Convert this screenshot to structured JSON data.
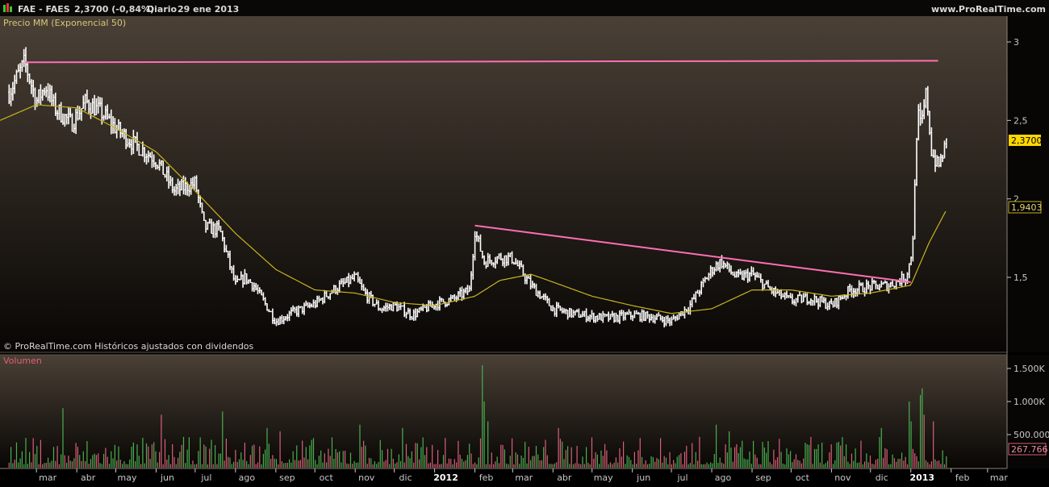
{
  "header": {
    "ticker": "FAE - FAES",
    "quote": "2,3700 (-0,84%)",
    "period": "Diario",
    "date": "29 ene 2013",
    "site": "www.ProRealTime.com"
  },
  "price_panel": {
    "indicator_label": "Precio MM (Exponencial 50)",
    "copyright": "© ProRealTime.com Históricos ajustados con dividendos",
    "last_price_tag": "2,3700",
    "ema_tag": "1,9403"
  },
  "volume_panel": {
    "label": "Volumen",
    "last_volume_tag": "267.766"
  },
  "colors": {
    "background_top": "#4a4036",
    "background_bottom": "#080604",
    "price_bars": "#ffffff",
    "ema_line": "#c8b41e",
    "trend_lines": "#ff6eb4",
    "volume_up": "#4caf50",
    "volume_down": "#d9607a",
    "price_tag_bg": "#ffd700",
    "axis_text": "#c8c8c8"
  },
  "chart_data": [
    {
      "type": "ohlc",
      "title": "FAE - FAES",
      "y_ticks": [
        "3",
        "2,5",
        "2",
        "1,5"
      ],
      "y_tick_values": [
        3,
        2.5,
        2,
        1.5
      ],
      "ylim": [
        1.13,
        3.1
      ],
      "x_ticks": [
        "mar",
        "abr",
        "may",
        "jun",
        "jul",
        "ago",
        "sep",
        "oct",
        "nov",
        "dic",
        "2012",
        "feb",
        "mar",
        "abr",
        "may",
        "jun",
        "jul",
        "ago",
        "sep",
        "oct",
        "nov",
        "dic",
        "2013",
        "feb",
        "mar"
      ],
      "x_tick_dates": [
        "2011-03-01",
        "2011-04-01",
        "2011-05-01",
        "2011-06-01",
        "2011-07-01",
        "2011-08-01",
        "2011-09-01",
        "2011-10-01",
        "2011-11-01",
        "2011-12-01",
        "2012-01-01",
        "2012-02-01",
        "2012-03-01",
        "2012-04-01",
        "2012-05-01",
        "2012-06-01",
        "2012-07-01",
        "2012-08-01",
        "2012-09-01",
        "2012-10-01",
        "2012-11-01",
        "2012-12-01",
        "2013-01-01",
        "2013-02-01",
        "2013-03-01"
      ],
      "x_bold_ticks": [
        "2012",
        "2013"
      ],
      "price_series": {
        "name": "FAE - FAES",
        "x": [
          "2011-02-08",
          "2011-02-20",
          "2011-03-01",
          "2011-03-08",
          "2011-03-15",
          "2011-03-28",
          "2011-04-08",
          "2011-04-20",
          "2011-05-01",
          "2011-05-15",
          "2011-06-01",
          "2011-06-15",
          "2011-07-01",
          "2011-07-08",
          "2011-07-20",
          "2011-08-01",
          "2011-08-08",
          "2011-08-15",
          "2011-09-01",
          "2011-09-15",
          "2011-10-01",
          "2011-10-15",
          "2011-11-01",
          "2011-11-08",
          "2011-11-20",
          "2011-12-01",
          "2011-12-15",
          "2012-01-01",
          "2012-01-15",
          "2012-01-28",
          "2012-02-01",
          "2012-02-08",
          "2012-02-20",
          "2012-03-01",
          "2012-03-15",
          "2012-04-01",
          "2012-04-15",
          "2012-05-01",
          "2012-05-15",
          "2012-06-01",
          "2012-06-15",
          "2012-07-01",
          "2012-07-15",
          "2012-08-01",
          "2012-08-08",
          "2012-08-20",
          "2012-09-01",
          "2012-09-15",
          "2012-10-01",
          "2012-10-15",
          "2012-11-01",
          "2012-11-15",
          "2012-12-01",
          "2012-12-15",
          "2012-12-28",
          "2013-01-01",
          "2013-01-03",
          "2013-01-06",
          "2013-01-09",
          "2013-01-13",
          "2013-01-17",
          "2013-01-22",
          "2013-01-29"
        ],
        "close": [
          2.68,
          2.87,
          2.62,
          2.72,
          2.58,
          2.48,
          2.62,
          2.55,
          2.45,
          2.35,
          2.25,
          2.05,
          2.1,
          1.82,
          1.8,
          1.45,
          1.5,
          1.45,
          1.22,
          1.28,
          1.33,
          1.42,
          1.5,
          1.4,
          1.3,
          1.32,
          1.26,
          1.33,
          1.36,
          1.42,
          1.8,
          1.6,
          1.63,
          1.62,
          1.45,
          1.3,
          1.27,
          1.25,
          1.24,
          1.26,
          1.25,
          1.22,
          1.32,
          1.55,
          1.6,
          1.5,
          1.52,
          1.42,
          1.35,
          1.37,
          1.32,
          1.42,
          1.44,
          1.45,
          1.5,
          1.62,
          1.8,
          2.55,
          2.45,
          2.68,
          2.3,
          2.2,
          2.37
        ]
      },
      "ema_series": {
        "name": "Exponencial 50",
        "x": [
          "2011-02-01",
          "2011-03-01",
          "2011-04-01",
          "2011-05-01",
          "2011-06-01",
          "2011-07-01",
          "2011-08-01",
          "2011-09-01",
          "2011-10-01",
          "2011-11-01",
          "2011-12-01",
          "2012-01-01",
          "2012-02-01",
          "2012-02-20",
          "2012-03-15",
          "2012-04-01",
          "2012-05-01",
          "2012-06-01",
          "2012-07-01",
          "2012-08-01",
          "2012-09-01",
          "2012-10-01",
          "2012-11-01",
          "2012-12-01",
          "2013-01-01",
          "2013-01-15",
          "2013-01-29"
        ],
        "y": [
          2.5,
          2.6,
          2.58,
          2.45,
          2.3,
          2.05,
          1.78,
          1.55,
          1.42,
          1.4,
          1.34,
          1.32,
          1.38,
          1.48,
          1.52,
          1.47,
          1.38,
          1.32,
          1.27,
          1.3,
          1.42,
          1.42,
          1.38,
          1.4,
          1.45,
          1.72,
          1.94
        ]
      },
      "trend_lines": [
        {
          "from": {
            "x": "2011-02-20",
            "y": 2.87
          },
          "to": {
            "x": "2013-01-22",
            "y": 2.88
          }
        },
        {
          "from": {
            "x": "2012-02-01",
            "y": 1.83
          },
          "to": {
            "x": "2013-01-01",
            "y": 1.47
          }
        }
      ],
      "last_price": 2.37,
      "last_ema": 1.9403
    },
    {
      "type": "bar",
      "title": "Volumen",
      "y_ticks": [
        "1.500K",
        "1.000K",
        "500.000"
      ],
      "y_tick_values": [
        1500000,
        1000000,
        500000
      ],
      "ylim": [
        0,
        1600000
      ],
      "spikes": [
        {
          "x": "2011-03-22",
          "y": 900000,
          "dir": "up"
        },
        {
          "x": "2011-06-05",
          "y": 800000,
          "dir": "down"
        },
        {
          "x": "2011-07-22",
          "y": 850000,
          "dir": "up"
        },
        {
          "x": "2011-08-25",
          "y": 600000,
          "dir": "up"
        },
        {
          "x": "2011-09-05",
          "y": 550000,
          "dir": "down"
        },
        {
          "x": "2011-11-05",
          "y": 650000,
          "dir": "up"
        },
        {
          "x": "2011-12-08",
          "y": 600000,
          "dir": "up"
        },
        {
          "x": "2012-02-07",
          "y": 1550000,
          "dir": "up"
        },
        {
          "x": "2012-02-09",
          "y": 1000000,
          "dir": "up"
        },
        {
          "x": "2012-02-12",
          "y": 700000,
          "dir": "up"
        },
        {
          "x": "2012-04-05",
          "y": 600000,
          "dir": "down"
        },
        {
          "x": "2012-08-05",
          "y": 650000,
          "dir": "up"
        },
        {
          "x": "2012-08-15",
          "y": 550000,
          "dir": "up"
        },
        {
          "x": "2012-12-10",
          "y": 600000,
          "dir": "up"
        },
        {
          "x": "2012-12-30",
          "y": 1000000,
          "dir": "up"
        },
        {
          "x": "2013-01-02",
          "y": 700000,
          "dir": "up"
        },
        {
          "x": "2013-01-08",
          "y": 1100000,
          "dir": "up"
        },
        {
          "x": "2013-01-10",
          "y": 1200000,
          "dir": "up"
        },
        {
          "x": "2013-01-12",
          "y": 800000,
          "dir": "down"
        },
        {
          "x": "2013-01-18",
          "y": 700000,
          "dir": "down"
        }
      ],
      "typical_volume_range": [
        50000,
        350000
      ],
      "last_volume": 267766
    }
  ]
}
